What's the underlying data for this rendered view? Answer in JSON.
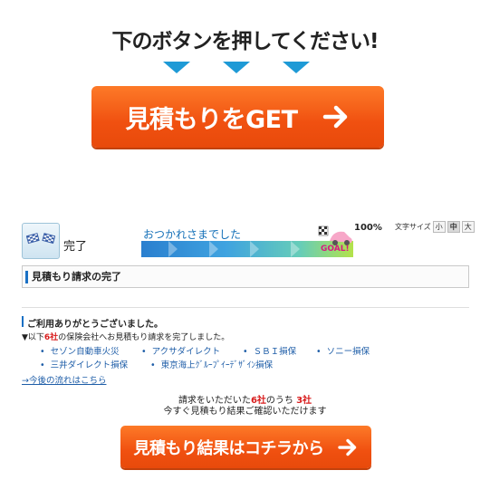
{
  "promo": {
    "headline": "下のボタンを押してください!",
    "button_label": "見積もりをGET"
  },
  "progress": {
    "step_label": "完了",
    "message": "おつかれさまでした",
    "percent_text": "100%",
    "goal_text": "GOAL!",
    "fraction_complete": 1.0,
    "font_size": {
      "label": "文字サイズ",
      "small": "小",
      "medium": "中",
      "large": "大",
      "selected": "中"
    }
  },
  "section": {
    "title": "見積もり請求の完了"
  },
  "result": {
    "thanks_heading": "ご利用ありがとうございました。",
    "desc_prefix": "▼以下",
    "desc_count": "6社",
    "desc_suffix": "の保険会社へお見積もり請求を完了しました。",
    "companies": [
      "セゾン自動車火災",
      "アクサダイレクト",
      "ＳＢＩ損保",
      "ソニー損保",
      "三井ダイレクト損保",
      "東京海上ｸﾞﾙｰﾌﾟｲｰﾃﾞｻﾞｲﾝ損保"
    ],
    "flow_link": "→今後の流れはこちら",
    "summary_line1_a": "請求をいただいた",
    "summary_line1_b": "6社",
    "summary_line1_c": "のうち",
    "summary_line1_d": "3社",
    "summary_line2": "今すぐ見積もり結果ご確認いただけます",
    "button_label": "見積もり結果はコチラから"
  },
  "colors": {
    "cta": "#f05010",
    "link": "#1f5ea8",
    "accent": "#1a70c4",
    "highlight": "#d81b1b",
    "arrow_triangles": "#1e9ad6"
  }
}
